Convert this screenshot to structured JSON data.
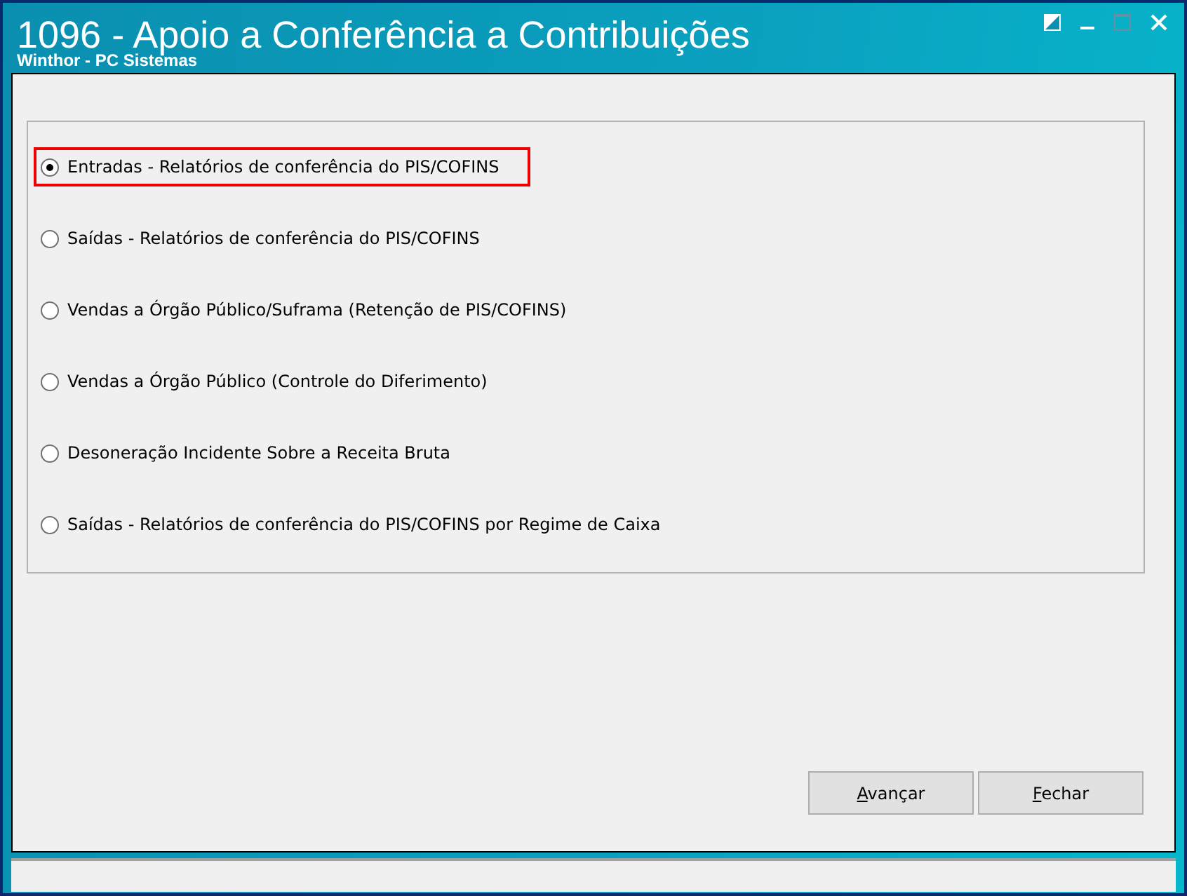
{
  "window": {
    "title": "1096 - Apoio a Conferência a Contribuições",
    "subtitle": "Winthor - PC Sistemas"
  },
  "options": [
    {
      "label": "Entradas - Relatórios de conferência do PIS/COFINS",
      "selected": true,
      "highlighted": true
    },
    {
      "label": "Saídas - Relatórios de conferência do PIS/COFINS",
      "selected": false,
      "highlighted": false
    },
    {
      "label": "Vendas a Órgão Público/Suframa (Retenção de PIS/COFINS)",
      "selected": false,
      "highlighted": false
    },
    {
      "label": "Vendas a Órgão Público (Controle do Diferimento)",
      "selected": false,
      "highlighted": false
    },
    {
      "label": "Desoneração Incidente Sobre a Receita Bruta",
      "selected": false,
      "highlighted": false
    },
    {
      "label": "Saídas - Relatórios de conferência do PIS/COFINS por Regime de Caixa",
      "selected": false,
      "highlighted": false
    }
  ],
  "buttons": [
    "Avançar",
    "Fechar"
  ]
}
